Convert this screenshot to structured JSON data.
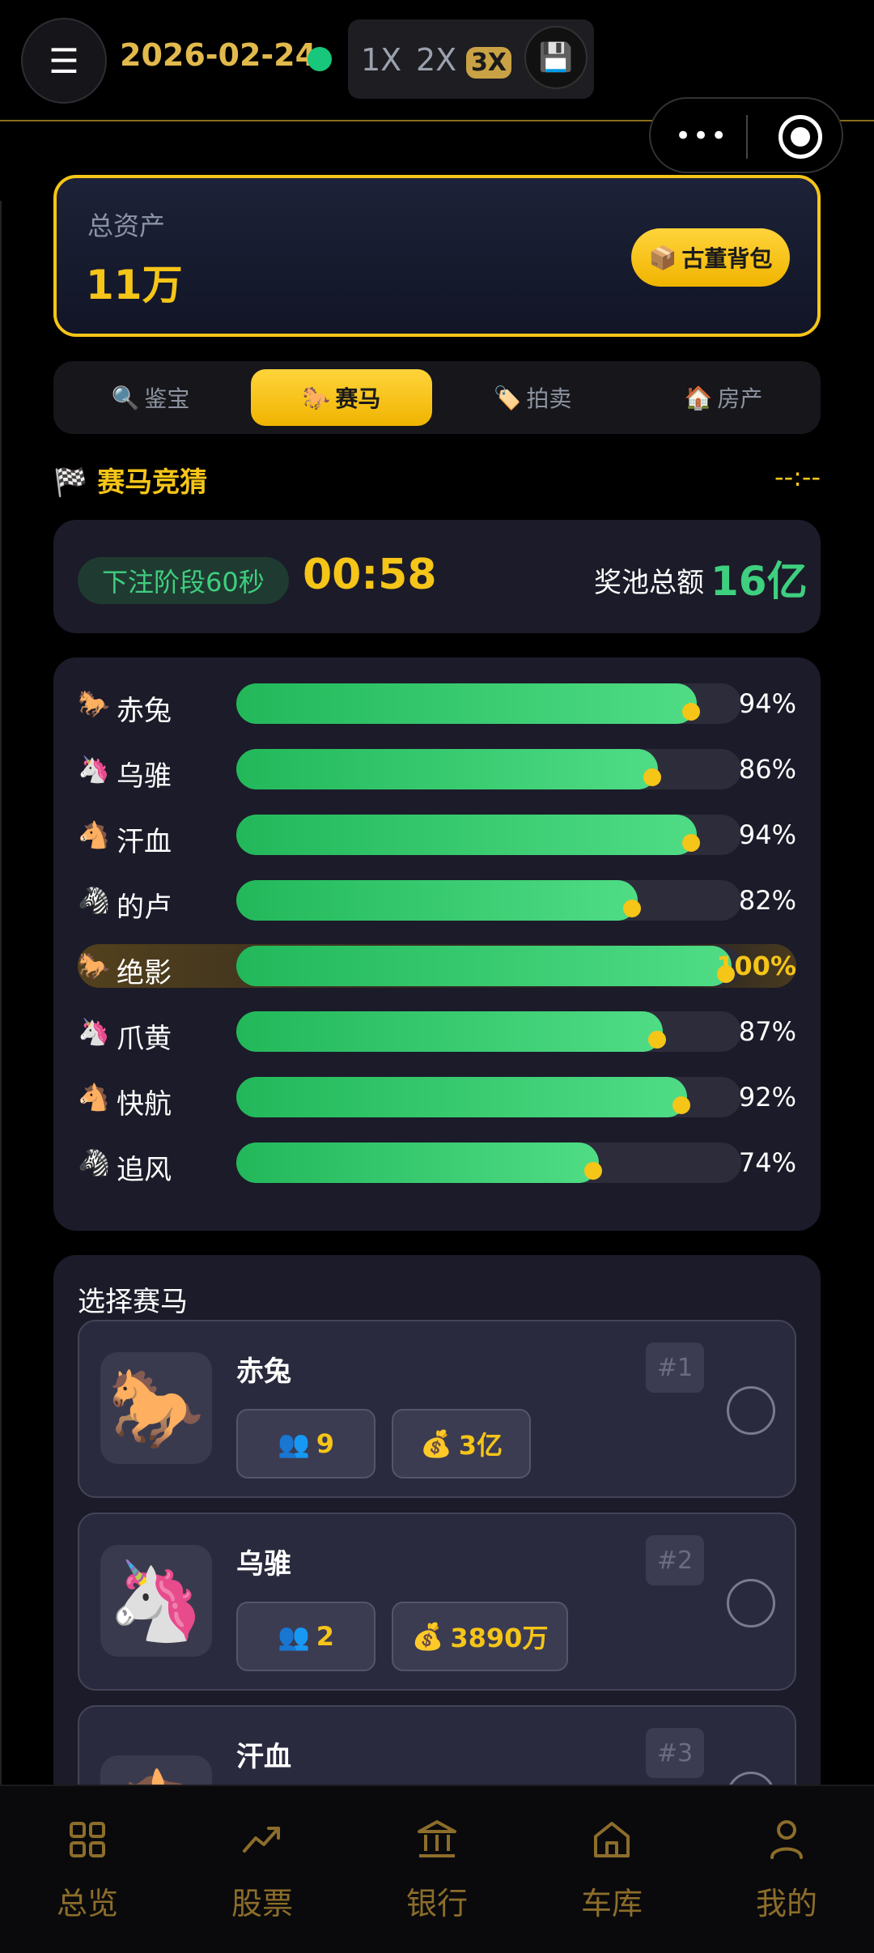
{
  "topbar": {
    "menu_icon": "menu-icon",
    "date": "2026-02-24",
    "speeds": [
      "1X",
      "2X",
      "3X"
    ],
    "active_speed": "3X",
    "save_icon": "💾",
    "status_color": "#17c77b"
  },
  "capsule": {
    "more_icon": "•••",
    "target_icon": "target-icon"
  },
  "assets": {
    "label": "总资产",
    "value": "11万",
    "antique_button": "古董背包",
    "antique_icon": "📦"
  },
  "tabs": [
    {
      "icon": "🔍",
      "label": "鉴宝"
    },
    {
      "icon": "🐎",
      "label": "赛马"
    },
    {
      "icon": "🏷️",
      "label": "拍卖"
    },
    {
      "icon": "🏠",
      "label": "房产"
    }
  ],
  "race": {
    "title_icon": "🏁",
    "title": "赛马竞猜",
    "time": "--:--",
    "phase": "下注阶段60秒",
    "countdown": "00:58",
    "pool_label": "奖池总额",
    "pool_value": "16亿"
  },
  "progress": [
    {
      "icon": "🐎",
      "name": "赤兔",
      "percent": 94,
      "label": "94%"
    },
    {
      "icon": "🦄",
      "name": "乌骓",
      "percent": 86,
      "label": "86%"
    },
    {
      "icon": "🐴",
      "name": "汗血",
      "percent": 94,
      "label": "94%"
    },
    {
      "icon": "🦓",
      "name": "的卢",
      "percent": 82,
      "label": "82%"
    },
    {
      "icon": "🐎",
      "name": "绝影",
      "percent": 100,
      "label": "100%",
      "leader": true
    },
    {
      "icon": "🦄",
      "name": "爪黄",
      "percent": 87,
      "label": "87%"
    },
    {
      "icon": "🐴",
      "name": "快航",
      "percent": 92,
      "label": "92%"
    },
    {
      "icon": "🦓",
      "name": "追风",
      "percent": 74,
      "label": "74%"
    }
  ],
  "choose": {
    "title": "选择赛马",
    "horses": [
      {
        "emoji": "🐎",
        "name": "赤兔",
        "bettors_icon": "👥",
        "bettors": "9",
        "money_icon": "💰",
        "amount": "3亿",
        "rank": "#1"
      },
      {
        "emoji": "🦄",
        "name": "乌骓",
        "bettors_icon": "👥",
        "bettors": "2",
        "money_icon": "💰",
        "amount": "3890万",
        "rank": "#2"
      },
      {
        "emoji": "🐴",
        "name": "汗血",
        "bettors_icon": "👥",
        "bettors": "",
        "money_icon": "💰",
        "amount": "",
        "rank": "#3"
      }
    ]
  },
  "nav": [
    {
      "label": "总览",
      "icon": "grid-icon"
    },
    {
      "label": "股票",
      "icon": "trend-icon"
    },
    {
      "label": "银行",
      "icon": "bank-icon"
    },
    {
      "label": "车库",
      "icon": "garage-icon"
    },
    {
      "label": "我的",
      "icon": "user-icon"
    }
  ],
  "colors": {
    "gold": "#f5c518",
    "green": "#3ecf7f",
    "nav": "#8c6d2a"
  }
}
